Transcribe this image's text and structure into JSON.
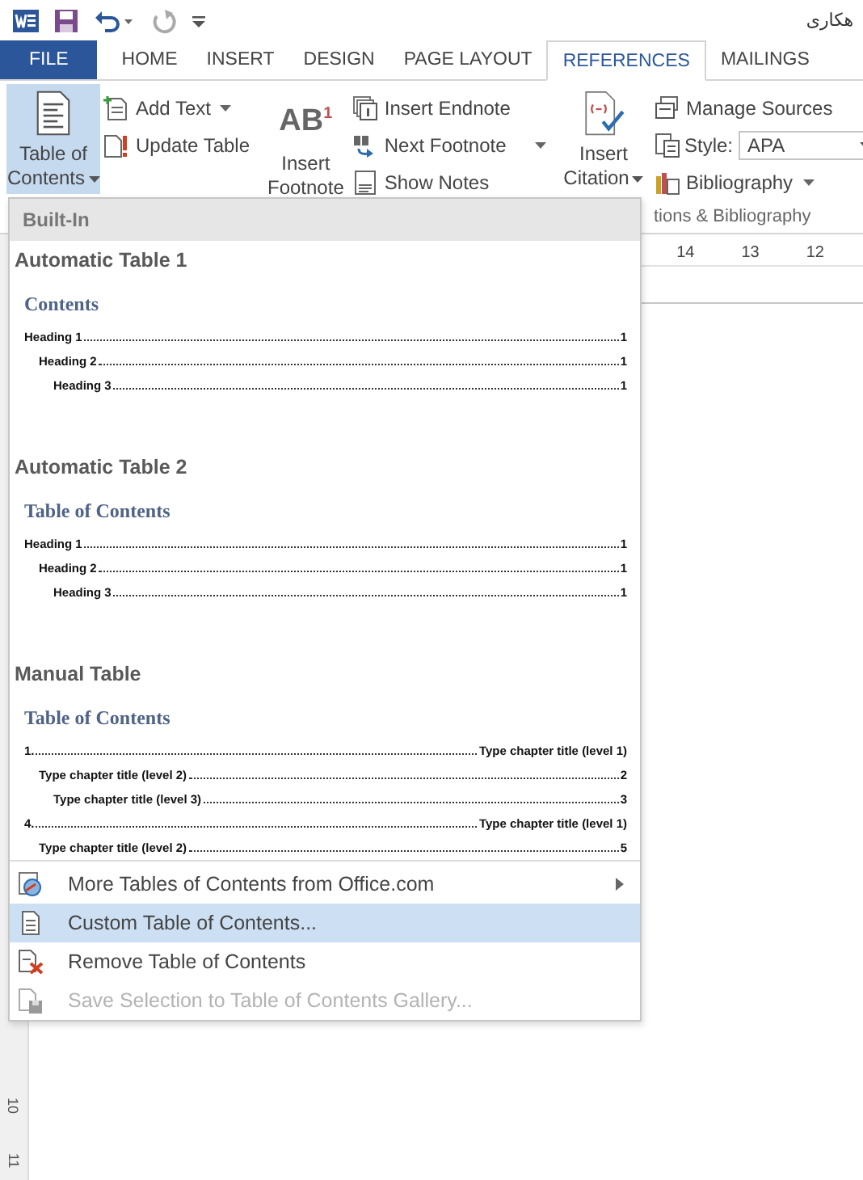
{
  "title_bar": {
    "title": "هکاری"
  },
  "tabs": [
    {
      "label": "FILE",
      "kind": "file",
      "selected": false
    },
    {
      "label": "HOME",
      "kind": "tab",
      "selected": false
    },
    {
      "label": "INSERT",
      "kind": "tab",
      "selected": false
    },
    {
      "label": "DESIGN",
      "kind": "tab",
      "selected": false
    },
    {
      "label": "PAGE LAYOUT",
      "kind": "tab",
      "selected": false
    },
    {
      "label": "REFERENCES",
      "kind": "tab",
      "selected": true
    },
    {
      "label": "MAILINGS",
      "kind": "tab",
      "selected": false
    }
  ],
  "ribbon": {
    "toc_group": {
      "large": {
        "lines": [
          "Table of",
          "Contents"
        ],
        "pressed": true,
        "has_menu": true
      },
      "small": [
        {
          "label": "Add Text",
          "has_menu": true
        },
        {
          "label": "Update Table",
          "has_menu": false
        }
      ]
    },
    "footnotes_group": {
      "large": {
        "glyph": "AB$^{1}$",
        "lines": [
          "Insert",
          "Footnote"
        ]
      },
      "small": [
        {
          "label": "Insert Endnote",
          "has_menu": false
        },
        {
          "label": "Next Footnote",
          "has_menu": true
        },
        {
          "label": "Show Notes",
          "has_menu": false
        }
      ]
    },
    "citations_group": {
      "large": {
        "lines": [
          "Insert",
          "Citation"
        ],
        "has_menu": true
      },
      "manage": "Manage Sources",
      "style_label": "Style:",
      "style_value": "APA",
      "bibliography": "Bibliography",
      "group_label": "tions & Bibliography"
    }
  },
  "ruler": {
    "numbers": [
      "14",
      "13",
      "12"
    ]
  },
  "vertical_ruler": {
    "numbers": [
      "10",
      "11"
    ]
  },
  "dropdown": {
    "header": "Built-In",
    "gallery": [
      {
        "title": "Automatic Table 1",
        "heading": "Contents",
        "entries": [
          {
            "text": "Heading 1",
            "page": "1",
            "children": [
              {
                "text": "Heading 2",
                "page": "1",
                "children": [
                  {
                    "text": "Heading 3",
                    "page": "1"
                  }
                ]
              }
            ]
          }
        ]
      },
      {
        "title": "Automatic Table 2",
        "heading": "Table of Contents",
        "entries": [
          {
            "text": "Heading 1",
            "page": "1",
            "children": [
              {
                "text": "Heading 2",
                "page": "1",
                "children": [
                  {
                    "text": "Heading 3",
                    "page": "1"
                  }
                ]
              }
            ]
          }
        ]
      },
      {
        "title": "Manual Table",
        "heading": "Table of Contents",
        "entries": [
          {
            "text": "1.",
            "page": "Type chapter title (level 1)",
            "children": [
              {
                "text": "Type chapter title (level 2)",
                "page": "2",
                "children": [
                  {
                    "text": "Type chapter title (level 3)",
                    "page": "3"
                  }
                ]
              }
            ]
          },
          {
            "text": "4.",
            "page": "Type chapter title (level 1)",
            "children": [
              {
                "text": "Type chapter title (level 2)",
                "page": "5"
              }
            ]
          }
        ]
      }
    ],
    "menu": [
      {
        "label": "More Tables of Contents from Office.com",
        "submenu": true,
        "selected": false,
        "disabled": false
      },
      {
        "label": "Custom Table of Contents...",
        "submenu": false,
        "selected": true,
        "disabled": false
      },
      {
        "label": "Remove Table of Contents",
        "submenu": false,
        "selected": false,
        "disabled": false
      },
      {
        "label": "Save Selection to Table of Contents Gallery...",
        "submenu": false,
        "selected": false,
        "disabled": true
      }
    ]
  }
}
